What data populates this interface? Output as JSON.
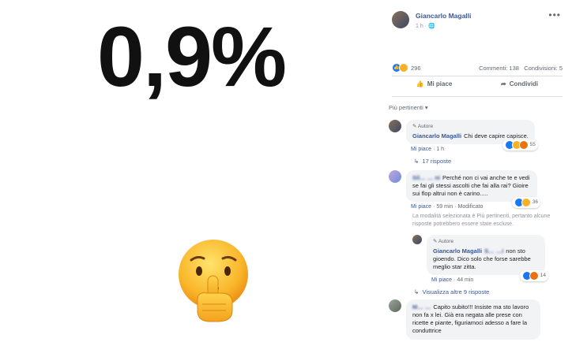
{
  "image": {
    "headline": "0,9%",
    "emoji": "shushing-face"
  },
  "post": {
    "author": "Giancarlo Magalli",
    "time": "1 h",
    "reaction_count": "296",
    "comments": "Commenti: 138",
    "shares": "Condivisioni: 5",
    "like_label": "Mi piace",
    "share_label": "Condividi"
  },
  "sort_label": "Più pertinenti ▾",
  "comments": [
    {
      "badge": "Autore",
      "name": "Giancarlo Magalli",
      "text": "Chi deve capire capisce.",
      "like": "Mi piace",
      "time": "1 h",
      "reactions": "55",
      "replies": "17 risposte"
    },
    {
      "name": "Sil… … ni",
      "text": "Perché non ci vai anche te e vedi se fai gli stessi ascolti che fai alla rai? Gioire sui flop altrui non è carino.....",
      "like": "Mi piace",
      "time": "59 min · Modificato",
      "reactions": "36",
      "note": "La modalità selezionata è Più pertinenti, pertanto alcune risposte potrebbero essere state escluse."
    },
    {
      "badge": "Autore",
      "name": "Giancarlo Magalli",
      "mention": "S… …i",
      "text": "non sto gioendo. Dico solo che forse sarebbe meglio star zitta.",
      "like": "Mi piace",
      "time": "44 min",
      "reactions": "14",
      "replies": "Visualizza altre 9 risposte"
    },
    {
      "name": "M… …",
      "text": "Capito subito!!! Insiste ma sto lavoro non fa x lei. Già era negata alle prese con ricette e piante, figuriamoci adesso a fare la conduttrice"
    }
  ]
}
